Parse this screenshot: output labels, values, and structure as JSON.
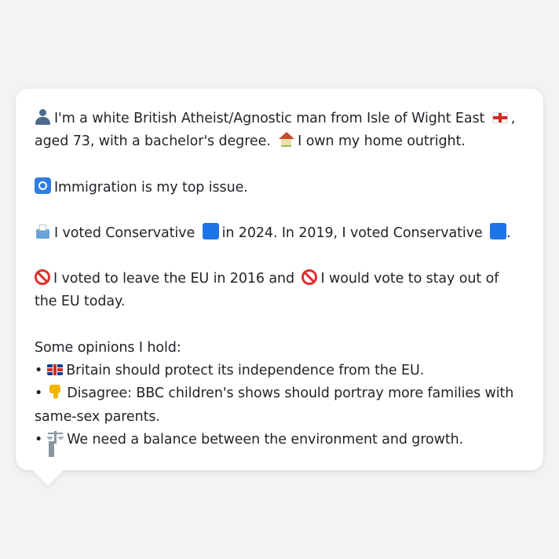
{
  "profile": {
    "identity_text_1": "I'm a white British Atheist/Agnostic man from Isle of Wight East",
    "identity_text_2": ", aged 73, with a bachelor's degree.",
    "home_text": "I own my home outright.",
    "top_issue_text": "Immigration is my top issue.",
    "vote_text_1": "I voted Conservative",
    "vote_text_2": "in 2024. In 2019, I voted Conservative",
    "vote_text_3": ".",
    "eu_text_1": "I voted to leave the EU in 2016 and",
    "eu_text_2": "I would vote to stay out of the EU today.",
    "opinions_heading": "Some opinions I hold:",
    "opinions": [
      {
        "bullet": "•",
        "text": "Britain should protect its independence from the EU."
      },
      {
        "bullet": "•",
        "text": "Disagree: BBC children's shows should portray more families with same-sex parents."
      },
      {
        "bullet": "•",
        "text": "We need a balance between the environment and growth."
      }
    ]
  },
  "icons": {
    "person": "bust-in-silhouette-icon",
    "england_flag": "england-flag-icon",
    "house": "house-icon",
    "passport": "passport-control-icon",
    "ballot": "ballot-box-icon",
    "party_color": "blue-square-icon",
    "prohibited": "prohibited-icon",
    "uk_flag": "uk-flag-icon",
    "thumbs_down": "thumbs-down-icon",
    "scales": "balance-scale-icon"
  },
  "colors": {
    "background": "#f2f3f5",
    "bubble": "#ffffff",
    "text": "#1f2328",
    "conservative_blue": "#1d73e8"
  }
}
